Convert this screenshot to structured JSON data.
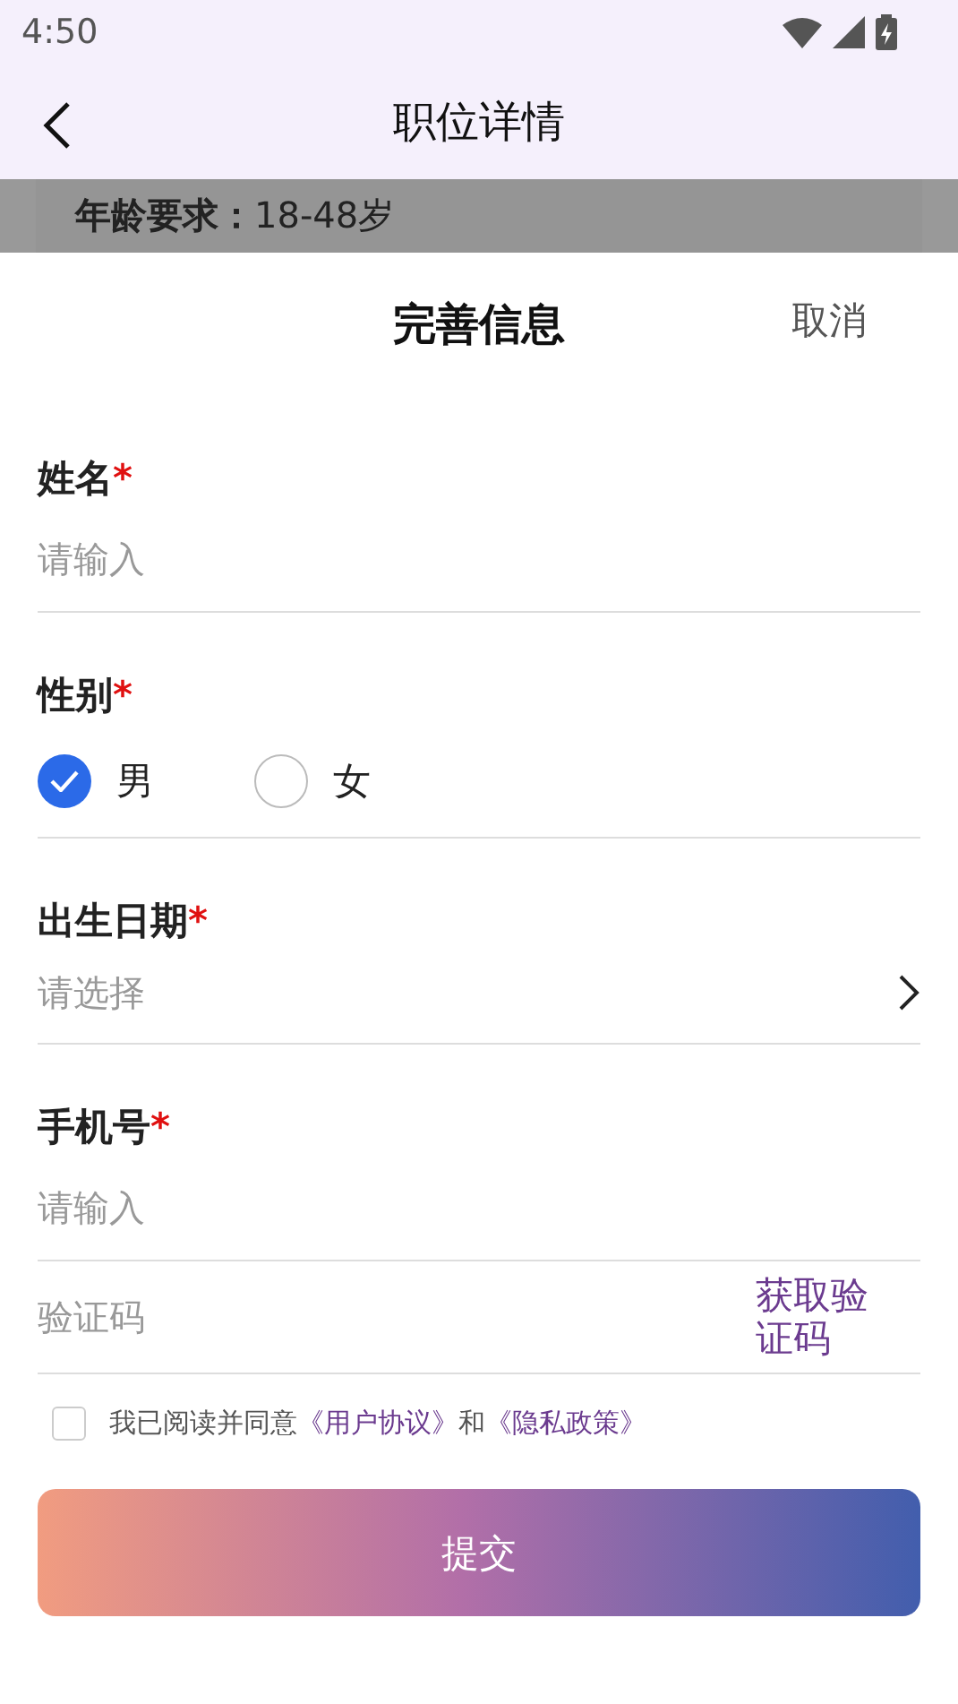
{
  "status_bar": {
    "time": "4:50"
  },
  "header": {
    "title": "职位详情"
  },
  "behind": {
    "label": "年龄要求：",
    "value": "18-48岁"
  },
  "sheet": {
    "title": "完善信息",
    "cancel": "取消"
  },
  "fields": [
    {
      "kind": "text",
      "label": "姓名",
      "mark": "*",
      "placeholder": "请输入"
    },
    {
      "kind": "radio",
      "label": "性别",
      "mark": "*",
      "options": [
        {
          "label": "男",
          "selected": true
        },
        {
          "label": "女",
          "selected": false
        }
      ]
    },
    {
      "kind": "select",
      "label": "出生日期",
      "mark": "*",
      "placeholder": "请选择"
    },
    {
      "kind": "text",
      "label": "手机号",
      "mark": "*",
      "placeholder": "请输入"
    },
    {
      "kind": "code",
      "placeholder": "验证码",
      "action": "获取验证码"
    }
  ],
  "agreement": {
    "checked": false,
    "parts": [
      {
        "kind": "text",
        "text": "我已阅读并同意"
      },
      {
        "kind": "link",
        "text": "《用户协议》"
      },
      {
        "kind": "text",
        "text": "和"
      },
      {
        "kind": "link",
        "text": "《隐私政策》"
      }
    ]
  },
  "submit": {
    "label": "提交"
  }
}
